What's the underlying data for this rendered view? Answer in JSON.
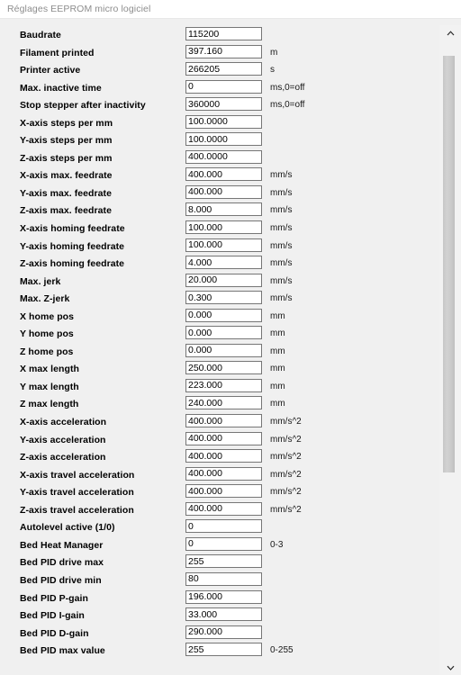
{
  "window": {
    "title": "Réglages EEPROM micro logiciel"
  },
  "scrollbar": {
    "up_icon": "chevron-up-icon",
    "down_icon": "chevron-down-icon"
  },
  "form": {
    "rows": [
      {
        "label": "Baudrate",
        "value": "115200",
        "unit": ""
      },
      {
        "label": "Filament printed",
        "value": "397.160",
        "unit": "m"
      },
      {
        "label": "Printer active",
        "value": "266205",
        "unit": "s"
      },
      {
        "label": "Max. inactive time",
        "value": "0",
        "unit": "ms,0=off"
      },
      {
        "label": "Stop stepper after inactivity",
        "value": "360000",
        "unit": "ms,0=off"
      },
      {
        "label": "X-axis steps per mm",
        "value": "100.0000",
        "unit": ""
      },
      {
        "label": "Y-axis steps per mm",
        "value": "100.0000",
        "unit": ""
      },
      {
        "label": "Z-axis steps per mm",
        "value": "400.0000",
        "unit": ""
      },
      {
        "label": "X-axis max. feedrate",
        "value": "400.000",
        "unit": "mm/s"
      },
      {
        "label": "Y-axis max. feedrate",
        "value": "400.000",
        "unit": "mm/s"
      },
      {
        "label": "Z-axis max. feedrate",
        "value": "8.000",
        "unit": "mm/s"
      },
      {
        "label": "X-axis homing feedrate",
        "value": "100.000",
        "unit": "mm/s"
      },
      {
        "label": "Y-axis homing feedrate",
        "value": "100.000",
        "unit": "mm/s"
      },
      {
        "label": "Z-axis homing feedrate",
        "value": "4.000",
        "unit": "mm/s"
      },
      {
        "label": "Max. jerk",
        "value": "20.000",
        "unit": "mm/s"
      },
      {
        "label": "Max. Z-jerk",
        "value": "0.300",
        "unit": "mm/s"
      },
      {
        "label": "X home pos",
        "value": "0.000",
        "unit": "mm"
      },
      {
        "label": "Y home pos",
        "value": "0.000",
        "unit": "mm"
      },
      {
        "label": "Z home pos",
        "value": "0.000",
        "unit": "mm"
      },
      {
        "label": "X max length",
        "value": "250.000",
        "unit": "mm"
      },
      {
        "label": "Y max length",
        "value": "223.000",
        "unit": "mm"
      },
      {
        "label": "Z max length",
        "value": "240.000",
        "unit": "mm"
      },
      {
        "label": "X-axis acceleration",
        "value": "400.000",
        "unit": "mm/s^2"
      },
      {
        "label": "Y-axis acceleration",
        "value": "400.000",
        "unit": "mm/s^2"
      },
      {
        "label": "Z-axis acceleration",
        "value": "400.000",
        "unit": "mm/s^2"
      },
      {
        "label": "X-axis travel acceleration",
        "value": "400.000",
        "unit": "mm/s^2"
      },
      {
        "label": "Y-axis travel acceleration",
        "value": "400.000",
        "unit": "mm/s^2"
      },
      {
        "label": "Z-axis travel acceleration",
        "value": "400.000",
        "unit": "mm/s^2"
      },
      {
        "label": "Autolevel active (1/0)",
        "value": "0",
        "unit": ""
      },
      {
        "label": "Bed Heat Manager",
        "value": "0",
        "unit": "0-3"
      },
      {
        "label": "Bed PID drive max",
        "value": "255",
        "unit": ""
      },
      {
        "label": "Bed PID drive min",
        "value": "80",
        "unit": ""
      },
      {
        "label": "Bed PID P-gain",
        "value": "196.000",
        "unit": ""
      },
      {
        "label": "Bed PID I-gain",
        "value": "33.000",
        "unit": ""
      },
      {
        "label": "Bed PID D-gain",
        "value": "290.000",
        "unit": ""
      },
      {
        "label": "Bed PID max value",
        "value": "255",
        "unit": "0-255"
      }
    ]
  },
  "colors": {
    "window_bg": "#f0f0f0",
    "titlebar_bg": "#ffffff",
    "title_text": "#8d8d8d",
    "input_bg": "#ffffff",
    "input_border": "#767676",
    "label_text": "#000000",
    "scroll_thumb": "#cdcdcd",
    "scroll_track": "#f2f2f2"
  }
}
